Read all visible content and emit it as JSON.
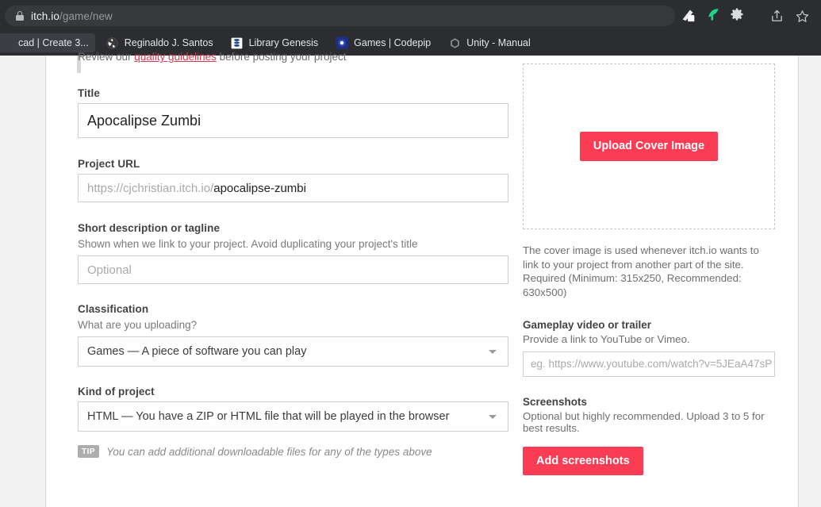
{
  "browser": {
    "url_host": "itch.io",
    "url_path": "/game/new",
    "lock_icon": "lock-icon",
    "actions": [
      {
        "name": "share-icon",
        "label": "Share"
      },
      {
        "name": "bookmark-star-icon",
        "label": "Bookmark"
      }
    ],
    "extensions": [
      {
        "name": "pen-extension-icon",
        "label": "Pen tool extension"
      },
      {
        "name": "green-bird-extension-icon",
        "label": "Extension"
      },
      {
        "name": "gear-icon",
        "label": "Settings"
      }
    ],
    "bookmarks": [
      {
        "name": "bookmark-tinkercad",
        "label": "cad | Create 3...",
        "favicon": "generic-favicon"
      },
      {
        "name": "bookmark-reginaldo-santos",
        "label": "Reginaldo J. Santos",
        "favicon": "globe-icon"
      },
      {
        "name": "bookmark-library-genesis",
        "label": "Library Genesis",
        "favicon": "book-icon"
      },
      {
        "name": "bookmark-games-codepip",
        "label": "Games | Codepip",
        "favicon": "circle-dot-icon"
      },
      {
        "name": "bookmark-unity-manual",
        "label": "Unity - Manual",
        "favicon": "unity-icon"
      }
    ]
  },
  "notice": {
    "before": "Review our ",
    "link": "quality guidelines",
    "after": " before posting your project"
  },
  "form": {
    "title": {
      "label": "Title",
      "value": "Apocalipse Zumbi"
    },
    "project_url": {
      "label": "Project URL",
      "prefix": "https://cjchristian.itch.io/",
      "slug": "apocalipse-zumbi"
    },
    "short_description": {
      "label": "Short description or tagline",
      "hint": "Shown when we link to your project. Avoid duplicating your project's title",
      "placeholder": "Optional",
      "value": ""
    },
    "classification": {
      "label": "Classification",
      "hint": "What are you uploading?",
      "selected": "Games — A piece of software you can play"
    },
    "kind_of_project": {
      "label": "Kind of project",
      "selected": "HTML — You have a ZIP or HTML file that will be played in the browser"
    },
    "tip": {
      "badge": "TIP",
      "text": "You can add additional downloadable files for any of the types above"
    }
  },
  "sidebar": {
    "cover": {
      "upload_button": "Upload Cover Image",
      "help": "The cover image is used whenever itch.io wants to link to your project from another part of the site. Required (Minimum: 315x250, Recommended: 630x500)"
    },
    "gameplay_video": {
      "label": "Gameplay video or trailer",
      "hint": "Provide a link to YouTube or Vimeo.",
      "placeholder": "eg. https://www.youtube.com/watch?v=5JEaA47sP",
      "value": ""
    },
    "screenshots": {
      "label": "Screenshots",
      "hint": "Optional but highly recommended. Upload 3 to 5 for best results.",
      "add_button": "Add screenshots"
    }
  },
  "colors": {
    "accent_red": "#fa3c55",
    "link_red": "#d63b52",
    "chrome_bg": "#2b2d31",
    "page_bg": "#f2f2f2"
  }
}
